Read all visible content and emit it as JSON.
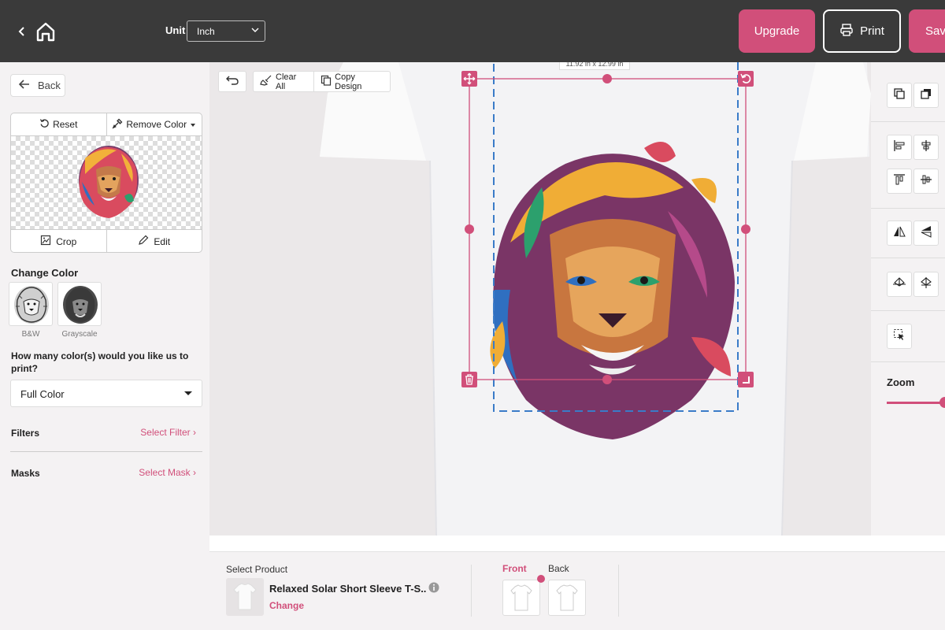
{
  "topbar": {
    "unit_label": "Unit",
    "unit_value": "Inch",
    "upgrade_label": "Upgrade",
    "print_label": "Print",
    "save_label": "Save"
  },
  "left": {
    "back_label": "Back",
    "reset_label": "Reset",
    "remove_color_label": "Remove Color",
    "crop_label": "Crop",
    "edit_label": "Edit",
    "change_color_title": "Change Color",
    "swatches": [
      "B&W",
      "Grayscale"
    ],
    "colors_question": "How many color(s) would you like us to print?",
    "color_count_value": "Full Color",
    "filters_label": "Filters",
    "select_filter_label": "Select Filter",
    "masks_label": "Masks",
    "select_mask_label": "Select Mask"
  },
  "canvas": {
    "clear_all_label": "Clear All",
    "copy_design_label": "Copy Design",
    "dimensions_label": "11.92 in x 12.99 in"
  },
  "right": {
    "zoom_label": "Zoom",
    "zoom_level": 0.95
  },
  "bottom": {
    "select_product_label": "Select Product",
    "product_name": "Relaxed Solar Short Sleeve T-S...",
    "change_label": "Change",
    "front_label": "Front",
    "back_label": "Back"
  },
  "colors": {
    "accent": "#d14f7a",
    "topbar": "#3a3a3a",
    "guide": "#3a7bc8"
  }
}
